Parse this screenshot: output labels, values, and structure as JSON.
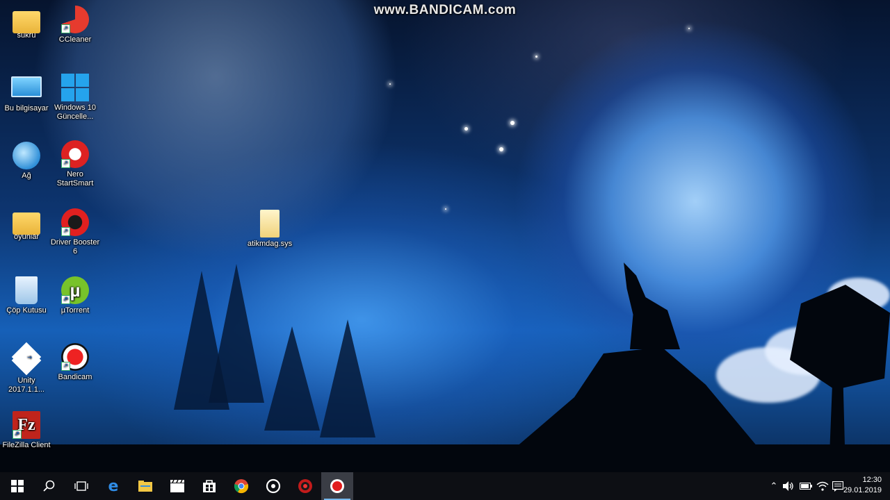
{
  "watermark": "www.BANDICAM.com",
  "desktop_icons": [
    {
      "label": "sukru",
      "icon": "user-folder-icon"
    },
    {
      "label": "CCleaner",
      "icon": "ccleaner-icon"
    },
    {
      "label": "Bu bilgisayar",
      "icon": "computer-icon"
    },
    {
      "label": "Windows 10 Güncelle...",
      "icon": "windows-update-icon"
    },
    {
      "label": "Ağ",
      "icon": "network-icon"
    },
    {
      "label": "Nero StartSmart",
      "icon": "nero-icon"
    },
    {
      "label": "oyunlar",
      "icon": "folder-icon"
    },
    {
      "label": "Driver Booster 6",
      "icon": "driver-booster-icon"
    },
    {
      "label": "Çöp Kutusu",
      "icon": "recycle-bin-icon"
    },
    {
      "label": "µTorrent",
      "icon": "utorrent-icon"
    },
    {
      "label": "Unity 2017.1.1...",
      "icon": "unity-icon"
    },
    {
      "label": "Bandicam",
      "icon": "bandicam-icon"
    },
    {
      "label": "FileZilla Client",
      "icon": "filezilla-icon"
    },
    {
      "label": "atikmdag.sys",
      "icon": "system-file-icon"
    }
  ],
  "taskbar": {
    "apps": [
      "start-icon",
      "search-icon",
      "task-view-icon",
      "edge-icon",
      "file-explorer-icon",
      "movies-tv-icon",
      "store-icon",
      "chrome-icon",
      "groove-music-icon",
      "driver-booster-taskbar-icon",
      "bandicam-taskbar-icon"
    ],
    "clock_time": "12:30",
    "clock_date": "29.01.2019"
  },
  "colors": {
    "taskbar_bg": "#0d0f14",
    "active_indicator": "#76b9ed"
  }
}
